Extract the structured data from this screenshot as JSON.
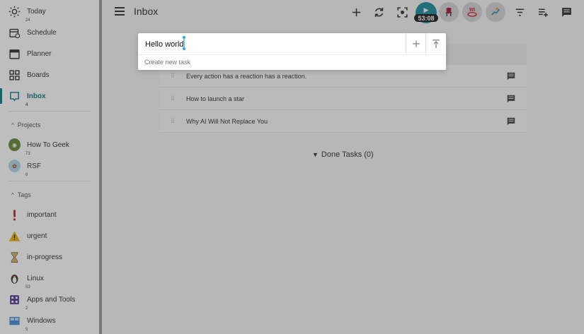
{
  "sidebar": {
    "main_items": [
      {
        "label": "Today",
        "icon": "sun-icon",
        "count": "24"
      },
      {
        "label": "Schedule",
        "icon": "calendar-clock-icon"
      },
      {
        "label": "Planner",
        "icon": "calendar-icon"
      },
      {
        "label": "Boards",
        "icon": "boards-grid-icon"
      },
      {
        "label": "Inbox",
        "icon": "inbox-icon",
        "count": "4",
        "active": true
      }
    ],
    "projects_heading": "Projects",
    "projects": [
      {
        "label": "How To Geek",
        "count": "73"
      },
      {
        "label": "RSF",
        "count": "6"
      }
    ],
    "tags_heading": "Tags",
    "tags": [
      {
        "label": "important",
        "icon": "exclamation-icon"
      },
      {
        "label": "urgent",
        "icon": "warning-icon"
      },
      {
        "label": "in-progress",
        "icon": "hourglass-icon"
      },
      {
        "label": "Linux",
        "icon": "penguin-icon",
        "count": "53"
      },
      {
        "label": "Apps and Tools",
        "icon": "apps-icon",
        "count": "2"
      },
      {
        "label": "Windows",
        "icon": "windows-icon",
        "count": "5"
      }
    ]
  },
  "header": {
    "title": "Inbox",
    "timer": "53:08"
  },
  "tasks": [
    {
      "title": "Every action has a reaction has a reaction."
    },
    {
      "title": "How to launch a star"
    },
    {
      "title": "Why AI Will Not Replace You"
    }
  ],
  "done": {
    "label": "Done Tasks (0)"
  },
  "add_task": {
    "value": "Hello world",
    "hint": "Create new task"
  },
  "colors": {
    "accent": "#117a85",
    "timer": "#1f8ea0"
  }
}
